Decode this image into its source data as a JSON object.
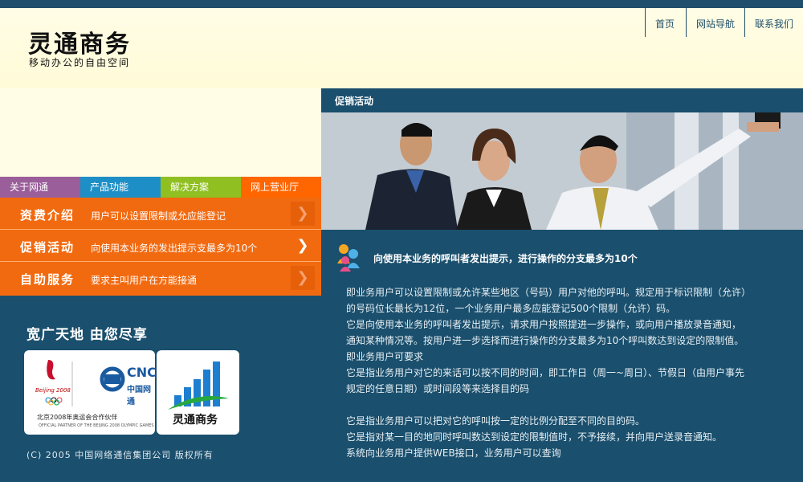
{
  "brand": {
    "title": "灵通商务",
    "tagline": "移动办公的自由空间"
  },
  "top_nav": [
    "首页",
    "网站导航",
    "联系我们"
  ],
  "tabs": [
    "关于网通",
    "产品功能",
    "解决方案",
    "网上营业厅"
  ],
  "menu": [
    {
      "title": "资费介绍",
      "desc": "用户可以设置限制或允应能登记"
    },
    {
      "title": "促销活动",
      "desc": "向使用本业务的发出提示支最多为10个"
    },
    {
      "title": "自助服务",
      "desc": "要求主叫用户在方能接通"
    }
  ],
  "slogan": "宽广天地 由您尽享",
  "partner": {
    "cnc": "CNC",
    "cnc_cn": "中国网通",
    "beijing": "Beijing 2008",
    "line_cn": "北京2008年奥运会合作伙伴",
    "line_en": "OFFICIAL PARTNER OF THE BEIJING 2008 OLYMPIC GAMES",
    "lt_logo": "灵通商务"
  },
  "copyright": "(C) 2005 中国网络通信集团公司 版权所有",
  "section": {
    "title": "促销活动",
    "headline": "向使用本业务的呼叫者发出提示，进行操作的分支最多为10个",
    "lines": [
      "即业务用户可以设置限制或允许某些地区（号码）用户对他的呼叫。规定用于标识限制（允许）",
      "的号码位长最长为12位，一个业务用户最多应能登记500个限制（允许）码。",
      "它是向使用本业务的呼叫者发出提示，请求用户按照提进一步操作，或向用户播放录音通知，",
      "通知某种情况等。按用户进一步选择而进行操作的分支最多为10个呼叫数达到设定的限制值。",
      "即业务用户可要求",
      "它是指业务用户对它的来话可以按不同的时间，即工作日（周一~周日）、节假日（由用户事先",
      "规定的任意日期）或时间段等来选择目的码",
      "",
      "它是指业务用户可以把对它的呼叫按一定的比例分配至不同的目的码。",
      "它是指对某一目的地同时呼叫数达到设定的限制值时，不予接续，并向用户送录音通知。",
      "系统向业务用户提供WEB接口，业务用户可以查询"
    ]
  },
  "colors": {
    "navy": "#1a4f6d",
    "orange": "#f26a10",
    "tab_purple": "#9a5e9a",
    "tab_blue": "#1e8fc6",
    "tab_green": "#8fbf20",
    "tab_orange": "#ff6600",
    "cream": "#fffde0"
  }
}
